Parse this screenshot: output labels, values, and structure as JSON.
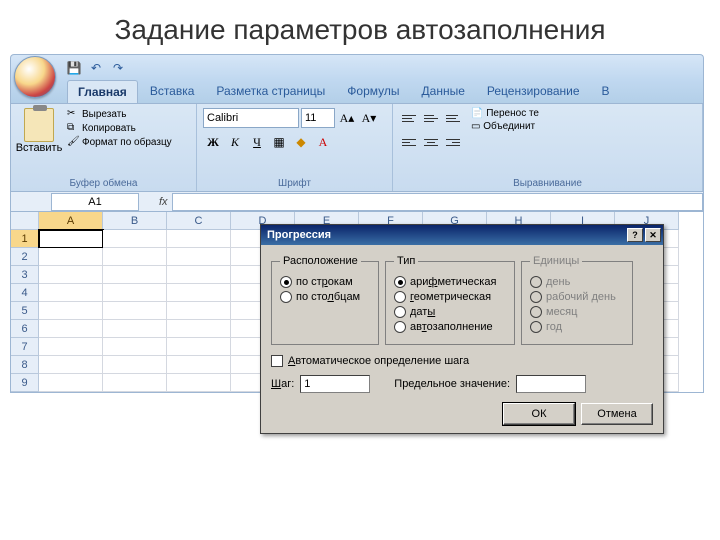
{
  "slide": {
    "title": "Задание параметров автозаполнения"
  },
  "tabs": {
    "home": "Главная",
    "insert": "Вставка",
    "layout": "Разметка страницы",
    "formulas": "Формулы",
    "data": "Данные",
    "review": "Рецензирование",
    "view_partial": "В"
  },
  "ribbon": {
    "clipboard": {
      "paste": "Вставить",
      "cut": "Вырезать",
      "copy": "Копировать",
      "format_painter": "Формат по образцу",
      "title": "Буфер обмена"
    },
    "font": {
      "name": "Calibri",
      "size": "11",
      "bold": "Ж",
      "italic": "К",
      "underline": "Ч",
      "title": "Шрифт"
    },
    "align": {
      "wrap": "Перенос те",
      "merge": "Объединит",
      "title": "Выравнивание"
    }
  },
  "namebox": {
    "ref": "A1"
  },
  "columns": [
    "A",
    "B",
    "C",
    "D",
    "E",
    "F",
    "G",
    "H",
    "I",
    "J"
  ],
  "rows": [
    "1",
    "2",
    "3",
    "4",
    "5",
    "6",
    "7",
    "8",
    "9"
  ],
  "dialog": {
    "title": "Прогрессия",
    "group_location": "Расположение",
    "loc_rows": "по строкам",
    "loc_cols": "по столбцам",
    "group_type": "Тип",
    "type_arith": "арифметическая",
    "type_geom": "геометрическая",
    "type_dates": "даты",
    "type_autofill": "автозаполнение",
    "group_units": "Единицы",
    "unit_day": "день",
    "unit_workday": "рабочий день",
    "unit_month": "месяц",
    "unit_year": "год",
    "auto_step": "Автоматическое определение шага",
    "step_label": "Шаг:",
    "step_value": "1",
    "limit_label": "Предельное значение:",
    "limit_value": "",
    "ok": "ОК",
    "cancel": "Отмена"
  }
}
